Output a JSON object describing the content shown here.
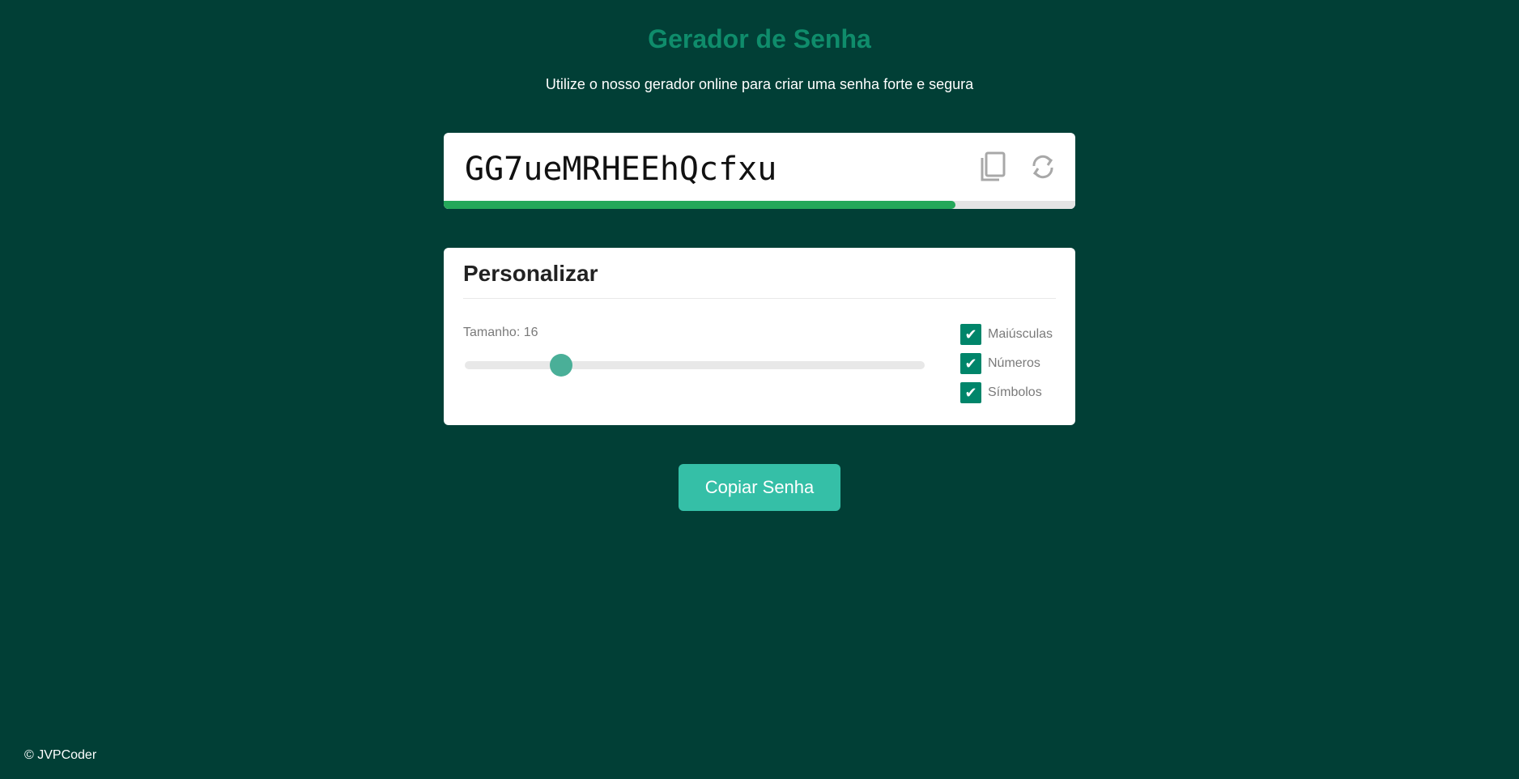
{
  "header": {
    "title": "Gerador de Senha",
    "subtitle": "Utilize o nosso gerador online para criar uma senha forte e segura"
  },
  "password": {
    "value": "GG7ueMRHEEhQcfxu",
    "strength_fraction": 0.81,
    "copy_icon": "copy-icon",
    "refresh_icon": "refresh-icon",
    "strength_color": "#24a85a"
  },
  "customize": {
    "title": "Personalizar",
    "size_label": "Tamanho:",
    "size_value": "16",
    "slider_fraction": 0.21,
    "options": [
      {
        "label": "Maiúsculas",
        "checked": true
      },
      {
        "label": "Números",
        "checked": true
      },
      {
        "label": "Símbolos",
        "checked": true
      }
    ]
  },
  "actions": {
    "copy_label": "Copiar Senha"
  },
  "footer": {
    "text": "© JVPCoder"
  },
  "colors": {
    "background": "#013f36",
    "title": "#0f8c6b",
    "accent": "#35bfa7",
    "checkbox": "#00856a"
  }
}
